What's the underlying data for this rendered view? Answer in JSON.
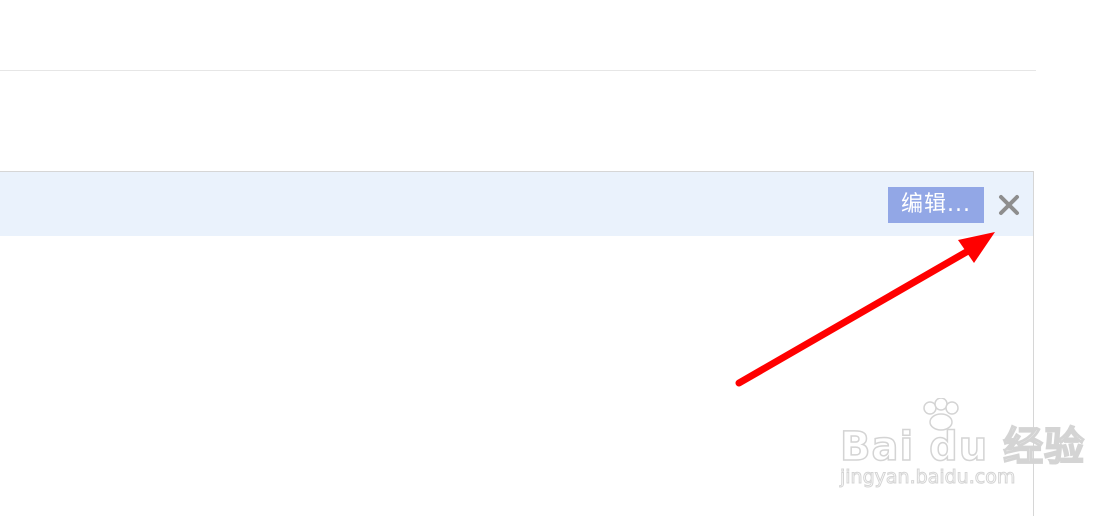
{
  "toolbar": {
    "edit_label": "编辑...",
    "close_icon": "close-icon",
    "edit_bg_color": "#92a7e6",
    "header_bg_color": "#eaf2fc"
  },
  "annotation": {
    "arrow_color": "#ff0000",
    "arrow_icon": "arrow-annotation"
  },
  "watermark": {
    "logo_text": "Bai du 经验",
    "url": "jingyan.baidu.com"
  }
}
